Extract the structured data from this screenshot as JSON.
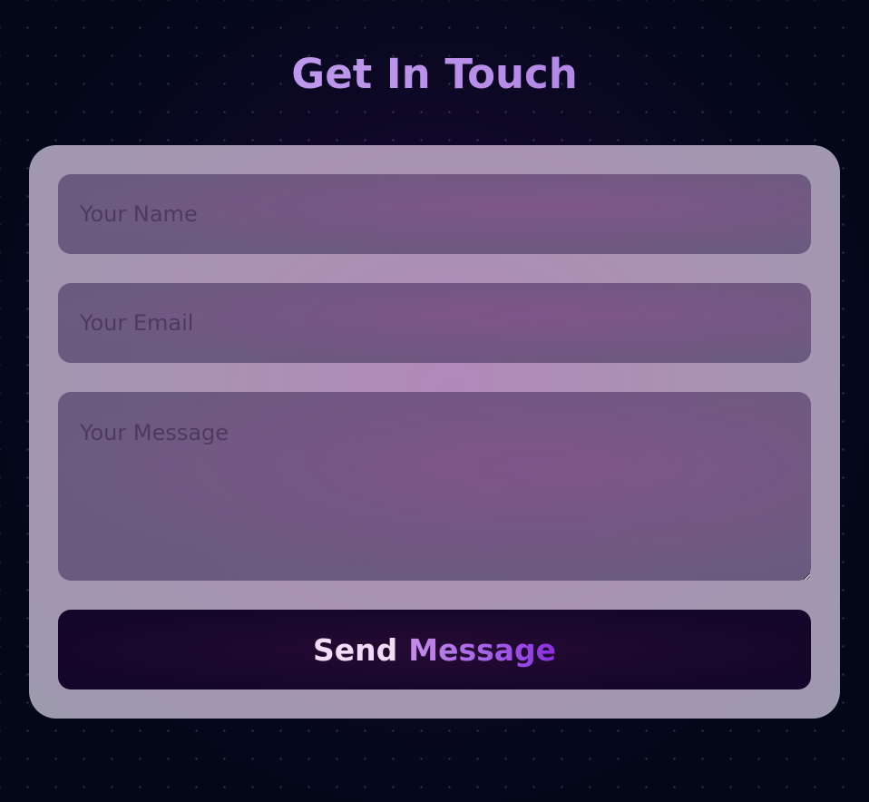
{
  "contact": {
    "title": "Get In Touch",
    "form": {
      "name_placeholder": "Your Name",
      "name_value": "",
      "email_placeholder": "Your Email",
      "email_value": "",
      "message_placeholder": "Your Message",
      "message_value": "",
      "send_label_word_1": "Send",
      "send_label_word_2": "Message"
    }
  },
  "colors": {
    "page_background": "#020818",
    "title_gradient_start": "#c9a8f0",
    "title_gradient_end": "#9a6fe0",
    "card_background": "#a993b3",
    "button_background": "#1a0830",
    "button_text": "#f1dbf6",
    "button_accent": "#a35ce8"
  }
}
